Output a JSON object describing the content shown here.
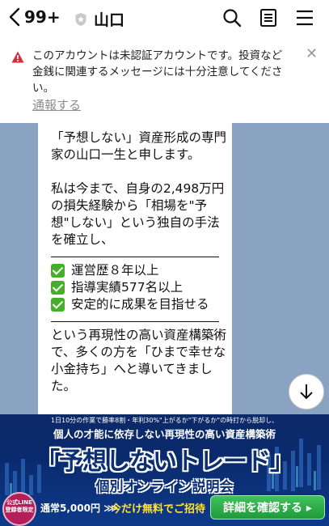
{
  "header": {
    "back_count": "99+",
    "chat_title": "山口"
  },
  "warning": {
    "text": "このアカウントは未認証アカウントです。投資など金銭に関連するメッセージには十分注意してください。",
    "report_link": "通報する"
  },
  "message": {
    "para1": "「予想しない」資産形成の専門家の山口一生と申します。",
    "para2": "私は今まで、自身の2,498万円の損失経験から「相場を\"予想\"しない」という独自の手法を確立し、",
    "checks": [
      "運営歴８年以上",
      "指導実績577名以上",
      "安定的に成果を目指せる"
    ],
    "para3": "という再現性の高い資産構築術で、多くの方を「ひまで幸せな小金持ち」へと導いてきました。"
  },
  "banner": {
    "top_text": "1日10分の作業で勝率8割・年利30%\"上がるか\"下がるか\"の時打から脱却し、",
    "sub_text": "個人の才能に依存しない再現性の高い資産構築術",
    "main_title": "「予想しないトレード」",
    "subtitle": "個別オンライン説明会",
    "badge_text": "公式LINE 登録者限定",
    "price": "通常5,000円 ⋙",
    "free": "今だけ無料でご招待",
    "cta": "詳細を確認する ▸"
  },
  "colors": {
    "chat_bg": "#8aa3c2",
    "warning_icon": "#e0283c",
    "check_green": "#44b02a",
    "banner_bg": "#0c2a68",
    "cta_green": "#2cae48"
  }
}
